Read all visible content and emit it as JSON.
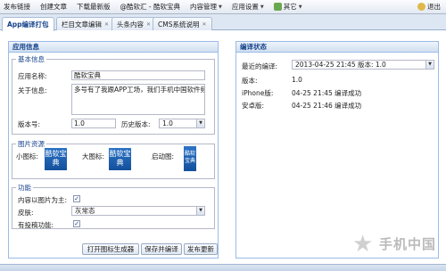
{
  "menubar": {
    "items": [
      {
        "label": "发布链接"
      },
      {
        "label": "创建文章"
      },
      {
        "label": "下载最新版"
      },
      {
        "label": "@酷软汇 - 酷软宝典"
      },
      {
        "label": "内容管理"
      },
      {
        "label": "应用设置"
      },
      {
        "label": "其它"
      }
    ],
    "exit_label": "退出"
  },
  "tabs": [
    {
      "label": "App编译打包"
    },
    {
      "label": "栏目文章编辑"
    },
    {
      "label": "头条内容"
    },
    {
      "label": "CMS系统说明"
    }
  ],
  "app_info": {
    "panel_title": "应用信息",
    "basic": {
      "legend": "基本信息",
      "name_label": "应用名称:",
      "name_value": "酷软宝典",
      "about_label": "关于信息:",
      "about_value": "多号有了我跟APP工场，我们手机中国软件频道资讯客户端可以分分钟就完成，非常不错!",
      "version_label": "版本号:",
      "version_value": "1.0",
      "history_label": "历史版本:",
      "history_value": "1.0"
    },
    "images": {
      "legend": "图片资源",
      "small_icon_label": "小图标:",
      "big_icon_label": "大图标:",
      "splash_label": "启动图:",
      "icon_text": "酷软宝典"
    },
    "features": {
      "legend": "功能",
      "image_main_label": "内容以图片为主:",
      "image_main_checked": true,
      "skin_label": "皮肤:",
      "skin_value": "灰常态",
      "shake_label": "有投稿功能:",
      "shake_checked": true
    },
    "buttons": {
      "icon_gen": "打开图标生成器",
      "save_compile": "保存并编译",
      "publish_update": "发布更新"
    }
  },
  "compile_status": {
    "panel_title": "编译状态",
    "latest_label": "最近的编译:",
    "latest_value": "2013-04-25 21:45 版本: 1.0",
    "version_label": "版本:",
    "version_value": "1.0",
    "iphone_label": "iPhone版:",
    "iphone_value": "04-25 21:45 编译成功",
    "android_label": "安卓版:",
    "android_value": "04-25 21:46 编译成功"
  },
  "watermark": {
    "text": "手机中国"
  },
  "colors": {
    "accent": "#15428b",
    "border": "#99bbe8",
    "icon_blue": "#1f63b4"
  }
}
